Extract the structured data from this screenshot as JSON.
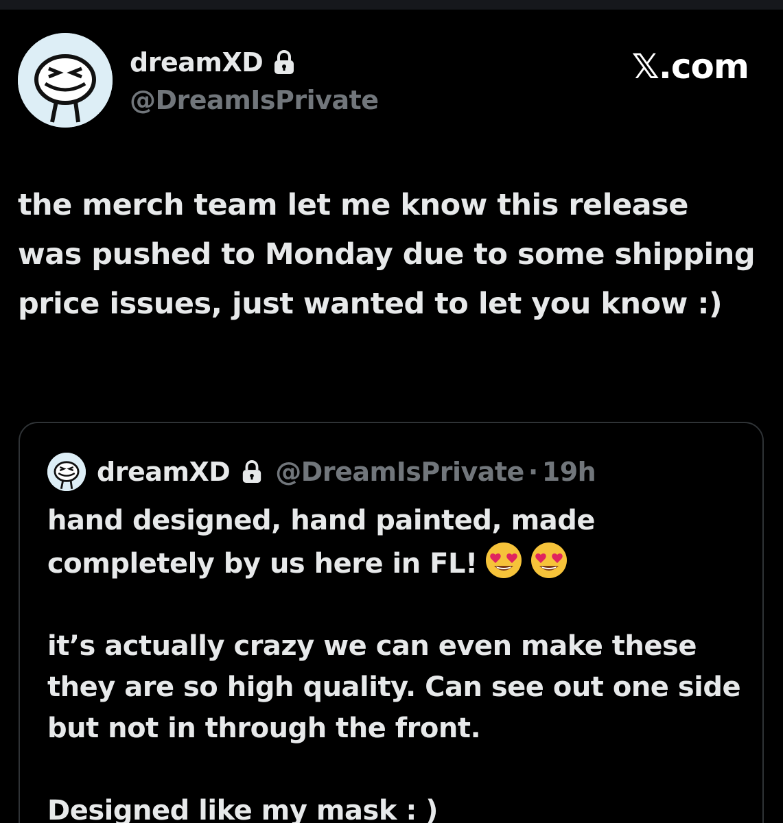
{
  "author": {
    "display_name": "dreamXD",
    "handle": "@DreamIsPrivate",
    "avatar_icon": "dream-smiley-avatar",
    "protected_icon": "lock-icon"
  },
  "watermark": "𝕏.com",
  "tweet": {
    "text": "the merch team let me know this release was pushed to Monday due to some shipping price issues, just wanted to let you know :)"
  },
  "quoted_tweet": {
    "display_name": "dreamXD",
    "handle": "@DreamIsPrivate",
    "separator": "·",
    "time": "19h",
    "paragraphs": [
      "hand designed, hand painted, made completely by us here in FL!",
      "it’s actually crazy we can even make these they are so high quality. Can see out one side but not in through the front.",
      "Designed like my mask : )"
    ],
    "emojis": [
      "heart-eyes-emoji",
      "heart-eyes-emoji"
    ]
  },
  "colors": {
    "background": "#000000",
    "primary_text": "#e7e9ea",
    "secondary_text": "#71767b",
    "border": "#2f3336",
    "avatar_bg": "#ddeef6"
  }
}
